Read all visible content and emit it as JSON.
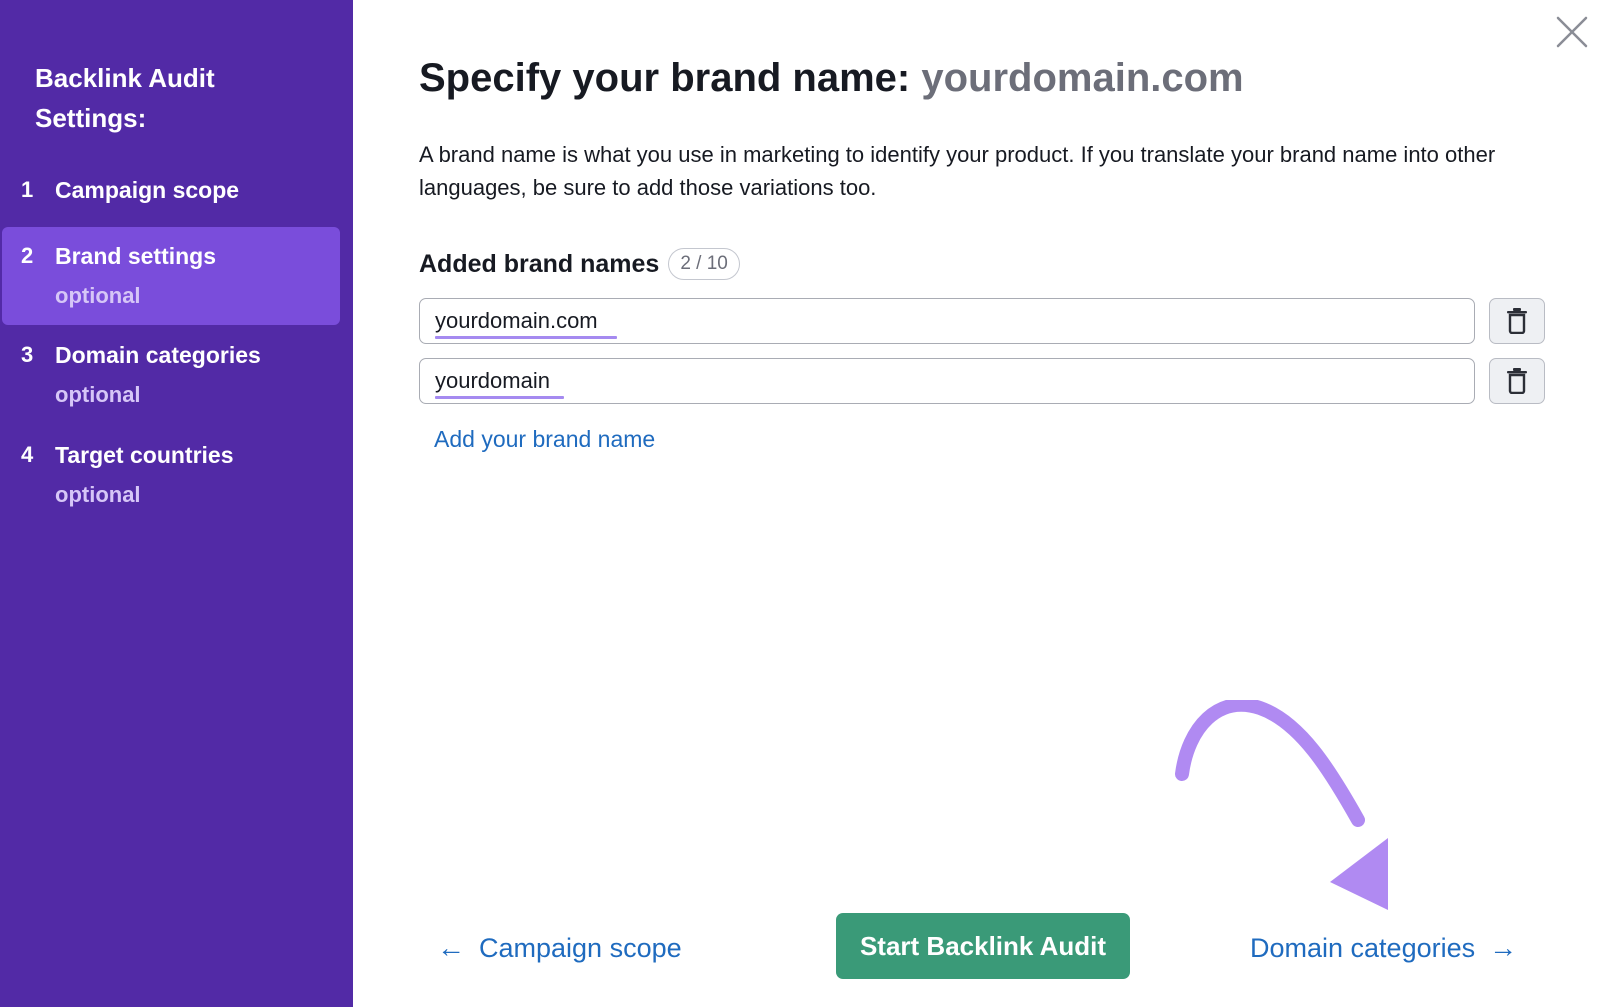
{
  "sidebar": {
    "title": "Backlink Audit Settings:",
    "steps": [
      {
        "number": "1",
        "label": "Campaign scope",
        "sub": ""
      },
      {
        "number": "2",
        "label": "Brand settings",
        "sub": "optional"
      },
      {
        "number": "3",
        "label": "Domain categories",
        "sub": "optional"
      },
      {
        "number": "4",
        "label": "Target countries",
        "sub": "optional"
      }
    ]
  },
  "main": {
    "title_prefix": "Specify your brand name: ",
    "title_domain": "yourdomain.com",
    "description": "A brand name is what you use in marketing to identify your product. If you translate your brand name into other languages, be sure to add those variations too.",
    "names_heading": "Added brand names",
    "names_count": "2 / 10",
    "brand_names": [
      "yourdomain.com",
      "yourdomain"
    ],
    "add_link": "Add your brand name"
  },
  "footer": {
    "back_arrow": "←",
    "back_label": "Campaign scope",
    "start_label": "Start Backlink Audit",
    "next_label": "Domain categories",
    "next_arrow": "→"
  },
  "colors": {
    "sidebar_bg": "#522aa6",
    "sidebar_active": "#7a4ddb",
    "primary_button": "#3a9a78",
    "link": "#1f6bbf",
    "annotation_arrow": "#b08af2"
  },
  "icons": {
    "close": "close-icon",
    "delete": "trash-icon",
    "back": "arrow-left-icon",
    "next": "arrow-right-icon"
  }
}
